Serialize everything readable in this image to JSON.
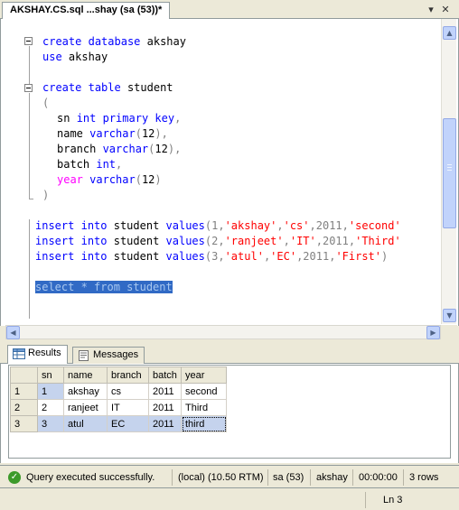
{
  "doc_tab": {
    "title": "AKSHAY.CS.sql ...shay (sa (53))*",
    "pin_glyph": "▾",
    "close_glyph": "✕"
  },
  "code": {
    "l1": {
      "kw1": "create",
      "kw2": "database",
      "rest": " akshay"
    },
    "l2": {
      "kw": "use",
      "rest": " akshay"
    },
    "l3": {
      "kw1": "create",
      "kw2": "table",
      "rest": " student"
    },
    "l4": {
      "p": "("
    },
    "l5": {
      "a": "sn ",
      "t": "int",
      "b": " ",
      "k": "primary key",
      "c": ","
    },
    "l6": {
      "a": "name ",
      "t": "varchar",
      "p1": "(",
      "n": "12",
      "p2": "),"
    },
    "l7": {
      "a": "branch ",
      "t": "varchar",
      "p1": "(",
      "n": "12",
      "p2": "),"
    },
    "l8": {
      "a": "batch ",
      "t": "int",
      "c": ","
    },
    "l9": {
      "f": "year",
      "b": " ",
      "t": "varchar",
      "p1": "(",
      "n": "12",
      "p2": ")"
    },
    "l10": {
      "p": ")"
    },
    "ins1": {
      "k1": "insert",
      "k2": "into",
      "r1": " student ",
      "k3": "values",
      "p1": "(1,",
      "s1": "'akshay'",
      "c1": ",",
      "s2": "'cs'",
      "c2": ",2011,",
      "s3": "'second'"
    },
    "ins2": {
      "k1": "insert",
      "k2": "into",
      "r1": " student ",
      "k3": "values",
      "p1": "(2,",
      "s1": "'ranjeet'",
      "c1": ",",
      "s2": "'IT'",
      "c2": ",2011,",
      "s3": "'Third'"
    },
    "ins3": {
      "k1": "insert",
      "k2": "into",
      "r1": " student ",
      "k3": "values",
      "p1": "(3,",
      "s1": "'atul'",
      "c1": ",",
      "s2": "'EC'",
      "c2": ",2011,",
      "s3": "'First'",
      "end": ")"
    },
    "select": "select * from student"
  },
  "tabs": {
    "results": "Results",
    "messages": "Messages"
  },
  "grid": {
    "columns": [
      "sn",
      "name",
      "branch",
      "batch",
      "year"
    ],
    "rows": [
      {
        "num": "1",
        "sn": "1",
        "name": "akshay",
        "branch": "cs",
        "batch": "2011",
        "year": "second"
      },
      {
        "num": "2",
        "sn": "2",
        "name": "ranjeet",
        "branch": "IT",
        "batch": "2011",
        "year": "Third"
      },
      {
        "num": "3",
        "sn": "3",
        "name": "atul",
        "branch": "EC",
        "batch": "2011",
        "year": "third"
      }
    ]
  },
  "query_status": {
    "message": "Query executed successfully.",
    "server": "(local) (10.50 RTM)",
    "login": "sa (53)",
    "database": "akshay",
    "elapsed": "00:00:00",
    "rows": "3 rows"
  },
  "app_status": {
    "line": "Ln 3"
  },
  "colors": {
    "keyword": "#0000ff",
    "function": "#ff00ff",
    "string": "#ff0000",
    "selection": "#316ac5",
    "success": "#3c9a2a"
  },
  "icons": {
    "results_tab": "grid-icon",
    "messages_tab": "messages-icon",
    "status": "checkmark-icon"
  }
}
